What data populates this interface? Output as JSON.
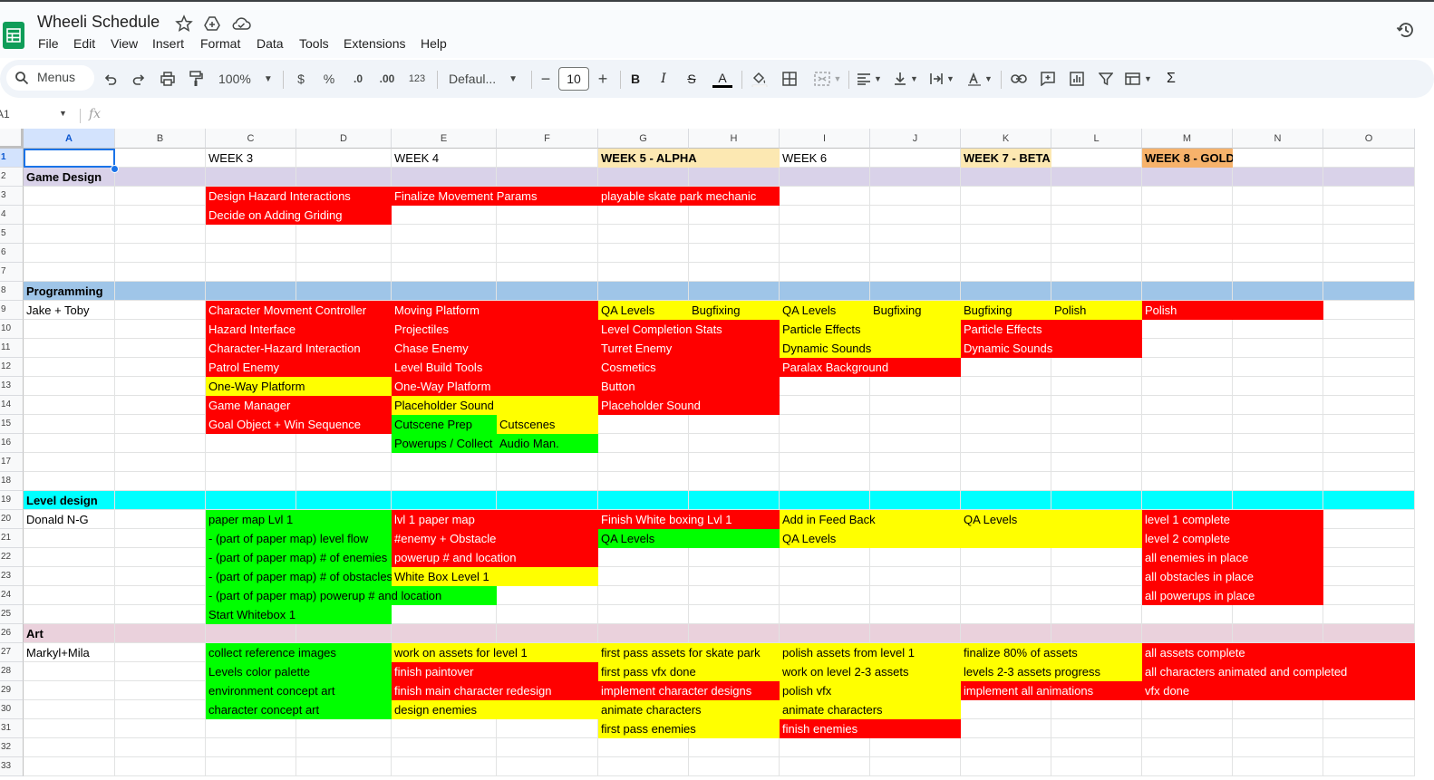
{
  "app": {
    "title": "Wheeli Schedule",
    "menus": [
      "File",
      "Edit",
      "View",
      "Insert",
      "Format",
      "Data",
      "Tools",
      "Extensions",
      "Help"
    ]
  },
  "toolbar": {
    "search_label": "Menus",
    "zoom": "100%",
    "currency": "$",
    "percent": "%",
    "dec_decrease": ".0",
    "dec_increase": ".00",
    "number_format": "123",
    "font": "Defaul...",
    "font_size": "10",
    "minus": "−",
    "plus": "+",
    "bold": "B",
    "italic": "I",
    "strike": "S",
    "text_color": "A",
    "sum": "Σ"
  },
  "formula_bar": {
    "cell_ref": "A1",
    "fx": "fx"
  },
  "columns": [
    "A",
    "B",
    "C",
    "D",
    "E",
    "F",
    "G",
    "H",
    "I",
    "J",
    "K",
    "L",
    "M",
    "N",
    "O"
  ],
  "rows": [
    "1",
    "2",
    "3",
    "4",
    "5",
    "6",
    "7",
    "8",
    "9",
    "10",
    "11",
    "12",
    "13",
    "14",
    "15",
    "16",
    "17",
    "18",
    "19",
    "20",
    "21",
    "22",
    "23",
    "24",
    "25",
    "26",
    "27",
    "28",
    "29",
    "30",
    "31",
    "32",
    "33"
  ],
  "colors": {
    "red": "#ff0000",
    "yellow": "#ffff00",
    "green": "#00ff00",
    "game_design_band": "#d9d2e9",
    "programming_band": "#9fc5e8",
    "level_design_band": "#00ffff",
    "art_band": "#ead1dc",
    "week5_alpha": "#fce8b2",
    "week8_gold": "#f6b26b"
  },
  "cells": [
    {
      "r": 1,
      "c": 3,
      "span": 2,
      "t": "WEEK 3"
    },
    {
      "r": 1,
      "c": 5,
      "span": 2,
      "t": "WEEK 4"
    },
    {
      "r": 1,
      "c": 7,
      "span": 2,
      "t": "WEEK 5 - ALPHA",
      "s": "wk5"
    },
    {
      "r": 1,
      "c": 9,
      "span": 2,
      "t": "WEEK 6"
    },
    {
      "r": 1,
      "c": 11,
      "span": 1,
      "t": "WEEK 7 - BETA",
      "s": "wk5"
    },
    {
      "r": 1,
      "c": 13,
      "span": 1,
      "t": "WEEK 8 - GOLD",
      "s": "wk8"
    },
    {
      "r": 2,
      "c": 1,
      "span": 1,
      "t": "Game Design",
      "s": "bold"
    },
    {
      "r": 3,
      "c": 3,
      "span": 2,
      "t": "Design Hazard Interactions",
      "s": "r"
    },
    {
      "r": 3,
      "c": 5,
      "span": 2,
      "t": "Finalize Movement Params",
      "s": "r"
    },
    {
      "r": 3,
      "c": 7,
      "span": 2,
      "t": "playable skate park mechanic",
      "s": "r"
    },
    {
      "r": 4,
      "c": 3,
      "span": 2,
      "t": "Decide on Adding Griding",
      "s": "r"
    },
    {
      "r": 8,
      "c": 1,
      "span": 1,
      "t": "Programming",
      "s": "bold"
    },
    {
      "r": 9,
      "c": 1,
      "span": 1,
      "t": "Jake + Toby"
    },
    {
      "r": 9,
      "c": 3,
      "span": 2,
      "t": "Character Movment Controller",
      "s": "r"
    },
    {
      "r": 9,
      "c": 5,
      "span": 2,
      "t": "Moving Platform",
      "s": "r"
    },
    {
      "r": 9,
      "c": 7,
      "span": 1,
      "t": "QA Levels",
      "s": "y"
    },
    {
      "r": 9,
      "c": 8,
      "span": 1,
      "t": "Bugfixing",
      "s": "y"
    },
    {
      "r": 9,
      "c": 9,
      "span": 1,
      "t": "QA Levels",
      "s": "y"
    },
    {
      "r": 9,
      "c": 10,
      "span": 1,
      "t": "Bugfixing",
      "s": "y"
    },
    {
      "r": 9,
      "c": 11,
      "span": 1,
      "t": "Bugfixing",
      "s": "y"
    },
    {
      "r": 9,
      "c": 12,
      "span": 1,
      "t": "Polish",
      "s": "y"
    },
    {
      "r": 9,
      "c": 13,
      "span": 2,
      "t": "Polish",
      "s": "r"
    },
    {
      "r": 10,
      "c": 3,
      "span": 2,
      "t": "Hazard Interface",
      "s": "r"
    },
    {
      "r": 10,
      "c": 5,
      "span": 2,
      "t": "Projectiles",
      "s": "r"
    },
    {
      "r": 10,
      "c": 7,
      "span": 2,
      "t": "Level Completion Stats",
      "s": "r"
    },
    {
      "r": 10,
      "c": 9,
      "span": 2,
      "t": "Particle Effects",
      "s": "y"
    },
    {
      "r": 10,
      "c": 11,
      "span": 2,
      "t": "Particle Effects",
      "s": "r"
    },
    {
      "r": 11,
      "c": 3,
      "span": 2,
      "t": "Character-Hazard Interaction",
      "s": "r"
    },
    {
      "r": 11,
      "c": 5,
      "span": 2,
      "t": "Chase Enemy",
      "s": "r"
    },
    {
      "r": 11,
      "c": 7,
      "span": 2,
      "t": "Turret Enemy",
      "s": "r"
    },
    {
      "r": 11,
      "c": 9,
      "span": 2,
      "t": "Dynamic Sounds",
      "s": "y"
    },
    {
      "r": 11,
      "c": 11,
      "span": 2,
      "t": "Dynamic Sounds",
      "s": "r"
    },
    {
      "r": 12,
      "c": 3,
      "span": 2,
      "t": "Patrol Enemy",
      "s": "r"
    },
    {
      "r": 12,
      "c": 5,
      "span": 2,
      "t": "Level Build Tools",
      "s": "r"
    },
    {
      "r": 12,
      "c": 7,
      "span": 2,
      "t": "Cosmetics",
      "s": "r"
    },
    {
      "r": 12,
      "c": 9,
      "span": 2,
      "t": "Paralax Background",
      "s": "r"
    },
    {
      "r": 13,
      "c": 3,
      "span": 2,
      "t": "One-Way Platform",
      "s": "y"
    },
    {
      "r": 13,
      "c": 5,
      "span": 2,
      "t": "One-Way Platform",
      "s": "r"
    },
    {
      "r": 13,
      "c": 7,
      "span": 2,
      "t": "Button",
      "s": "r"
    },
    {
      "r": 14,
      "c": 3,
      "span": 2,
      "t": "Game Manager",
      "s": "r"
    },
    {
      "r": 14,
      "c": 5,
      "span": 2,
      "t": "Placeholder Sound",
      "s": "y"
    },
    {
      "r": 14,
      "c": 7,
      "span": 2,
      "t": "Placeholder Sound",
      "s": "r"
    },
    {
      "r": 15,
      "c": 3,
      "span": 2,
      "t": "Goal Object + Win Sequence",
      "s": "r"
    },
    {
      "r": 15,
      "c": 5,
      "span": 1,
      "t": "Cutscene Prep",
      "s": "g"
    },
    {
      "r": 15,
      "c": 6,
      "span": 1,
      "t": "Cutscenes",
      "s": "y"
    },
    {
      "r": 16,
      "c": 5,
      "span": 1,
      "t": "Powerups / Collect",
      "s": "g"
    },
    {
      "r": 16,
      "c": 6,
      "span": 1,
      "t": "Audio Man.",
      "s": "g"
    },
    {
      "r": 19,
      "c": 1,
      "span": 1,
      "t": "Level design",
      "s": "bold"
    },
    {
      "r": 20,
      "c": 1,
      "span": 1,
      "t": "Donald N-G"
    },
    {
      "r": 20,
      "c": 3,
      "span": 2,
      "t": "paper map Lvl 1",
      "s": "g"
    },
    {
      "r": 20,
      "c": 5,
      "span": 2,
      "t": "lvl 1 paper map",
      "s": "r"
    },
    {
      "r": 20,
      "c": 7,
      "span": 2,
      "t": "Finish White boxing Lvl 1",
      "s": "r"
    },
    {
      "r": 20,
      "c": 9,
      "span": 2,
      "t": "Add in Feed Back",
      "s": "y"
    },
    {
      "r": 20,
      "c": 11,
      "span": 2,
      "t": "QA Levels",
      "s": "y"
    },
    {
      "r": 20,
      "c": 13,
      "span": 2,
      "t": "level 1 complete",
      "s": "r"
    },
    {
      "r": 21,
      "c": 3,
      "span": 2,
      "t": "- (part of paper map) level flow",
      "s": "g"
    },
    {
      "r": 21,
      "c": 5,
      "span": 2,
      "t": "#enemy + Obstacle",
      "s": "r"
    },
    {
      "r": 21,
      "c": 7,
      "span": 2,
      "t": "QA Levels",
      "s": "g"
    },
    {
      "r": 21,
      "c": 9,
      "span": 2,
      "t": "QA Levels",
      "s": "y"
    },
    {
      "r": 21,
      "c": 11,
      "span": 2,
      "t": "",
      "s": "y"
    },
    {
      "r": 21,
      "c": 13,
      "span": 2,
      "t": "level 2 complete",
      "s": "r"
    },
    {
      "r": 22,
      "c": 3,
      "span": 2,
      "t": "- (part of paper map) # of enemies",
      "s": "g"
    },
    {
      "r": 22,
      "c": 5,
      "span": 2,
      "t": "powerup # and location",
      "s": "r"
    },
    {
      "r": 22,
      "c": 13,
      "span": 2,
      "t": "all enemies in place",
      "s": "r"
    },
    {
      "r": 23,
      "c": 3,
      "span": 2,
      "t": "- (part of paper map) # of obstacles",
      "s": "g"
    },
    {
      "r": 23,
      "c": 5,
      "span": 2,
      "t": "White Box Level 1",
      "s": "y"
    },
    {
      "r": 23,
      "c": 13,
      "span": 2,
      "t": "all obstacles in place",
      "s": "r"
    },
    {
      "r": 24,
      "c": 3,
      "span": 3,
      "t": "- (part of paper map) powerup # and location",
      "s": "g"
    },
    {
      "r": 24,
      "c": 13,
      "span": 2,
      "t": "all powerups in place",
      "s": "r"
    },
    {
      "r": 25,
      "c": 3,
      "span": 2,
      "t": "Start Whitebox 1",
      "s": "g"
    },
    {
      "r": 26,
      "c": 1,
      "span": 1,
      "t": "Art",
      "s": "bold"
    },
    {
      "r": 27,
      "c": 1,
      "span": 1,
      "t": "Markyl+Mila"
    },
    {
      "r": 27,
      "c": 3,
      "span": 2,
      "t": "collect reference images",
      "s": "g"
    },
    {
      "r": 27,
      "c": 5,
      "span": 2,
      "t": "work on assets for level 1",
      "s": "y"
    },
    {
      "r": 27,
      "c": 7,
      "span": 2,
      "t": "first pass assets for skate park",
      "s": "y"
    },
    {
      "r": 27,
      "c": 9,
      "span": 2,
      "t": "polish assets from level 1",
      "s": "y"
    },
    {
      "r": 27,
      "c": 11,
      "span": 2,
      "t": "finalize 80% of assets",
      "s": "y"
    },
    {
      "r": 27,
      "c": 13,
      "span": 3,
      "t": "all assets complete",
      "s": "r"
    },
    {
      "r": 28,
      "c": 3,
      "span": 2,
      "t": "Levels color palette",
      "s": "g"
    },
    {
      "r": 28,
      "c": 5,
      "span": 2,
      "t": "finish paintover",
      "s": "r"
    },
    {
      "r": 28,
      "c": 7,
      "span": 2,
      "t": "first pass vfx done",
      "s": "y"
    },
    {
      "r": 28,
      "c": 9,
      "span": 2,
      "t": "work on level 2-3 assets",
      "s": "y"
    },
    {
      "r": 28,
      "c": 11,
      "span": 2,
      "t": "levels 2-3 assets progress",
      "s": "y"
    },
    {
      "r": 28,
      "c": 13,
      "span": 3,
      "t": "all characters animated and completed",
      "s": "r"
    },
    {
      "r": 29,
      "c": 3,
      "span": 2,
      "t": "environment concept art",
      "s": "g"
    },
    {
      "r": 29,
      "c": 5,
      "span": 2,
      "t": "finish main character redesign",
      "s": "r"
    },
    {
      "r": 29,
      "c": 7,
      "span": 2,
      "t": "implement character designs",
      "s": "r"
    },
    {
      "r": 29,
      "c": 9,
      "span": 2,
      "t": "polish vfx",
      "s": "y"
    },
    {
      "r": 29,
      "c": 11,
      "span": 2,
      "t": "implement all animations",
      "s": "r"
    },
    {
      "r": 29,
      "c": 13,
      "span": 3,
      "t": "vfx done",
      "s": "r"
    },
    {
      "r": 30,
      "c": 3,
      "span": 2,
      "t": "character concept art",
      "s": "g"
    },
    {
      "r": 30,
      "c": 5,
      "span": 2,
      "t": "design enemies",
      "s": "y"
    },
    {
      "r": 30,
      "c": 7,
      "span": 2,
      "t": "animate characters",
      "s": "y"
    },
    {
      "r": 30,
      "c": 9,
      "span": 2,
      "t": "animate characters",
      "s": "y"
    },
    {
      "r": 31,
      "c": 7,
      "span": 2,
      "t": "first pass enemies",
      "s": "y"
    },
    {
      "r": 31,
      "c": 9,
      "span": 2,
      "t": "finish enemies",
      "s": "r"
    }
  ],
  "bands": [
    {
      "r": 2,
      "color": "#d9d2e9"
    },
    {
      "r": 8,
      "color": "#9fc5e8"
    },
    {
      "r": 19,
      "color": "#00ffff"
    },
    {
      "r": 26,
      "color": "#ead1dc"
    }
  ]
}
